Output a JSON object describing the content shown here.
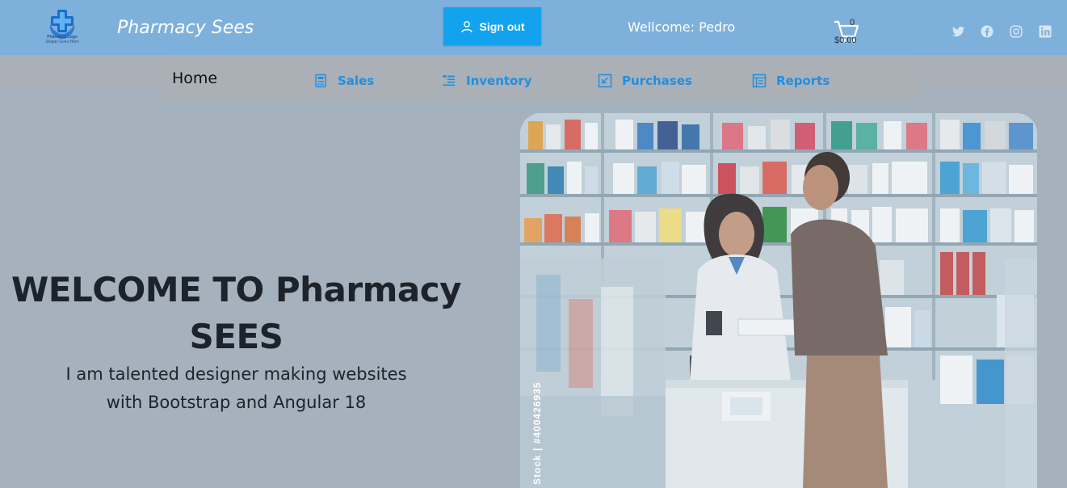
{
  "header": {
    "logo_name": "Pharmacy Logo",
    "logo_tagline": "Slogan Goes Here",
    "brand": "Pharmacy Sees",
    "signout_label": "Sign out",
    "welcome_text": "Wellcome: Pedro",
    "cart_count": "0",
    "cart_total": "$0.00",
    "social_icons": [
      "twitter-icon",
      "facebook-icon",
      "instagram-icon",
      "linkedin-icon"
    ]
  },
  "nav": {
    "home": "Home",
    "items": [
      {
        "label": "Sales",
        "icon": "calculator-icon"
      },
      {
        "label": "Inventory",
        "icon": "list-icon"
      },
      {
        "label": "Purchases",
        "icon": "box-arrow-icon"
      },
      {
        "label": "Reports",
        "icon": "report-icon"
      }
    ]
  },
  "hero": {
    "title_line1": "WELCOME TO Pharmacy",
    "title_line2": "SEES",
    "subtitle_line1": "I am talented designer making websites",
    "subtitle_line2": "with Bootstrap and Angular 18",
    "image_watermark": "Stock | #400426935"
  },
  "colors": {
    "header_bg": "#7eb0dc",
    "page_bg": "#a5b1bd",
    "accent": "#13a3ee",
    "nav_link": "#1f8fe2"
  }
}
